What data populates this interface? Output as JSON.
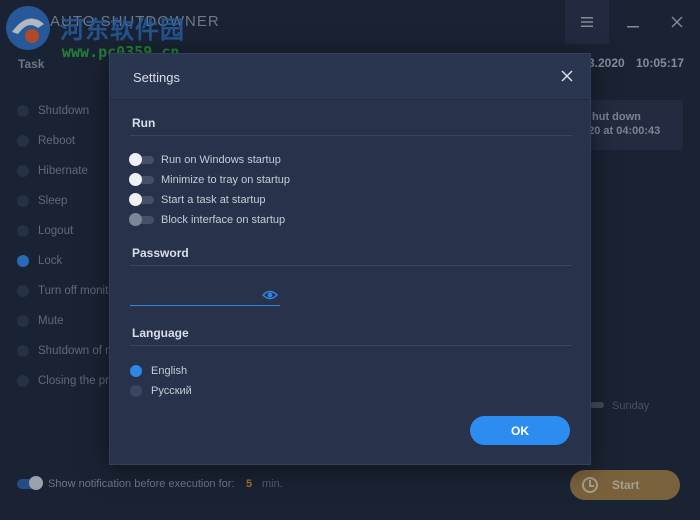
{
  "app": {
    "title": "AUTO SHUTDOWNER",
    "watermark_cn": "河东软件园",
    "watermark_url": "www.pc0359.cn"
  },
  "header": {
    "task_label": "Task",
    "date": "3.2020",
    "time": "10:05:17"
  },
  "tasks": [
    {
      "label": "Shutdown",
      "selected": false
    },
    {
      "label": "Reboot",
      "selected": false
    },
    {
      "label": "Hibernate",
      "selected": false
    },
    {
      "label": "Sleep",
      "selected": false
    },
    {
      "label": "Logout",
      "selected": false
    },
    {
      "label": "Lock",
      "selected": true
    },
    {
      "label": "Turn off monito",
      "selected": false
    },
    {
      "label": "Mute",
      "selected": false
    },
    {
      "label": "Shutdown of ne",
      "selected": false
    },
    {
      "label": "Closing the pro",
      "selected": false
    }
  ],
  "info_card": {
    "line1": "hut down",
    "line2": "020 at 04:00:43"
  },
  "schedule": {
    "sunday": "Sunday"
  },
  "bottom": {
    "notif_text": "Show notification before execution for:",
    "notif_value": "5",
    "notif_unit": "min.",
    "start_label": "Start"
  },
  "dialog": {
    "title": "Settings",
    "run": {
      "title": "Run",
      "options": [
        {
          "label": "Run on Windows startup",
          "enabled": true
        },
        {
          "label": "Minimize to tray on startup",
          "enabled": true
        },
        {
          "label": "Start a task at startup",
          "enabled": true
        },
        {
          "label": "Block interface on startup",
          "enabled": false
        }
      ]
    },
    "password": {
      "title": "Password",
      "value": ""
    },
    "language": {
      "title": "Language",
      "options": [
        {
          "label": "English",
          "selected": true
        },
        {
          "label": "Русский",
          "selected": false
        }
      ]
    },
    "ok_label": "OK"
  },
  "colors": {
    "accent": "#2d87e6",
    "start_button": "#9c7a45",
    "background": "#1e2738",
    "dialog": "#28324a"
  }
}
